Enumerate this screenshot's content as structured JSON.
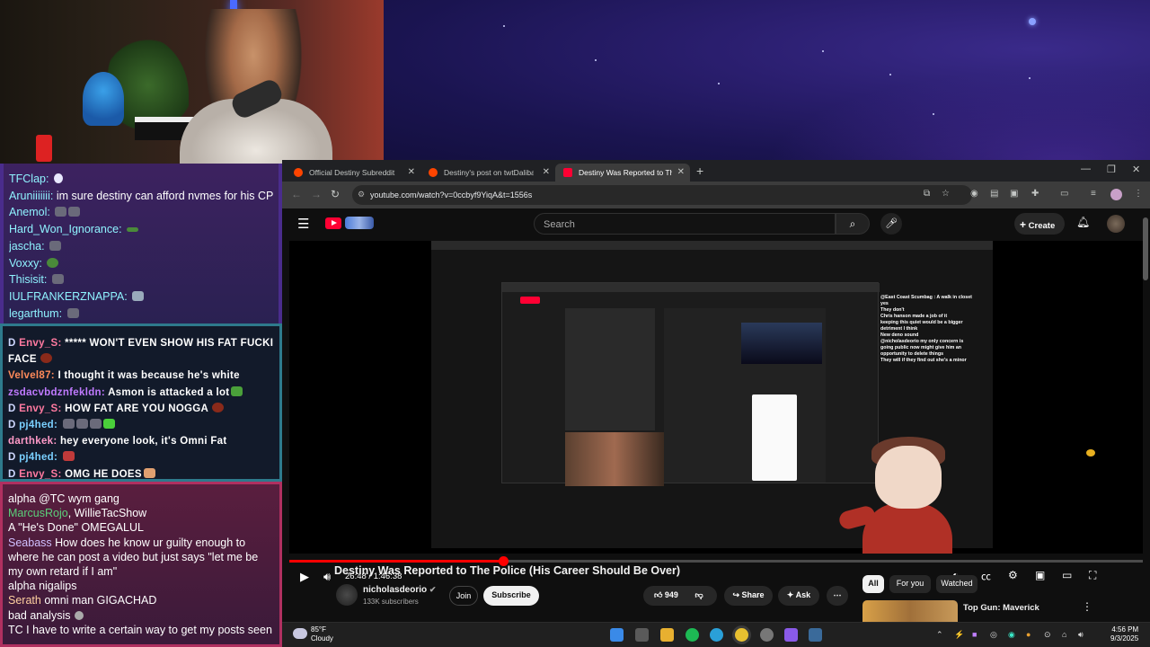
{
  "chat1": {
    "lines": [
      {
        "user": "TFClap:",
        "text": ""
      },
      {
        "user": "Aruniiiiiii:",
        "text": "im sure destiny can afford nvmes for his CP"
      },
      {
        "user": "Anemol:",
        "text": ""
      },
      {
        "user": "Hard_Won_Ignorance:",
        "text": ""
      },
      {
        "user": "jascha:",
        "text": ""
      },
      {
        "user": "Voxxy:",
        "text": ""
      },
      {
        "user": "Thisisit:",
        "text": ""
      },
      {
        "user": "IULFRANKERZNAPPA:",
        "text": ""
      },
      {
        "user": "legarthum:",
        "text": ""
      }
    ]
  },
  "chat2": {
    "lines": [
      {
        "pre": "D",
        "user": "Envy_S:",
        "text": "***** WON'T EVEN SHOW HIS FAT FUCKING",
        "ucolor": "#ff7aa0"
      },
      {
        "pre": "",
        "user": "",
        "text": "FACE",
        "ucolor": "#ffffff"
      },
      {
        "pre": "",
        "user": "Velvel87:",
        "text": "I thought it was because he's white",
        "ucolor": "#ff8a5a"
      },
      {
        "pre": "",
        "user": "zsdacvbdznfekldn:",
        "text": "Asmon is attacked a lot",
        "ucolor": "#c07aff"
      },
      {
        "pre": "D",
        "user": "Envy_S:",
        "text": "HOW FAT ARE YOU NOGGA",
        "ucolor": "#ff7aa0"
      },
      {
        "pre": "D",
        "user": "pj4hed:",
        "text": "",
        "ucolor": "#7ad0ff"
      },
      {
        "pre": "",
        "user": "darthkek:",
        "text": "hey everyone look, it's Omni Fat",
        "ucolor": "#ff9ac8"
      },
      {
        "pre": "D",
        "user": "pj4hed:",
        "text": "",
        "ucolor": "#7ad0ff"
      },
      {
        "pre": "D",
        "user": "Envy_S:",
        "text": "OMG HE DOES",
        "ucolor": "#ff7aa0"
      }
    ]
  },
  "chat3": {
    "lines": [
      {
        "user": "alpha",
        "text": "@TC wym gang",
        "ucolor": "#ffffff"
      },
      {
        "user": "MarcusRojo",
        "text": ", WillieTacShow",
        "ucolor": "#5ad07a"
      },
      {
        "user": "A",
        "text": "\"He's Done\" OMEGALUL",
        "ucolor": "#ffffff"
      },
      {
        "user": "Seabass",
        "text": "How does he know ur guilty enough to where he can post a video but just says \"let me be my own retard if I am\"",
        "ucolor": "#d0c0ff"
      },
      {
        "user": "alpha",
        "text": "nigalips",
        "ucolor": "#ffffff"
      },
      {
        "user": "Serath",
        "text": "omni man GIGACHAD",
        "ucolor": "#ffd0a0"
      },
      {
        "user": "bad analysis",
        "text": "",
        "ucolor": "#ffffff"
      },
      {
        "user": "TC",
        "text": "I have to write a certain way to get my posts seen",
        "ucolor": "#ffffff"
      }
    ]
  },
  "browser": {
    "tabs": [
      {
        "label": "Official Destiny Subreddit",
        "color": "#ff4500"
      },
      {
        "label": "Destiny's post on twtDaliban c...",
        "color": "#ff4500"
      },
      {
        "label": "Destiny Was Reported to The P...",
        "color": "#ff0033"
      }
    ],
    "url": "youtube.com/watch?v=0ccbyf9YiqA&t=1556s"
  },
  "youtube": {
    "search_placeholder": "Search",
    "create_label": "Create",
    "time": "26:48 / 1:46:38",
    "progress_fraction": 0.251,
    "video_title": "Destiny Was Reported to The Police (His Career Should Be Over)",
    "channel": "nicholasdeorio",
    "subs": "133K subscribers",
    "join": "Join",
    "subscribe": "Subscribe",
    "likes": "949",
    "share": "Share",
    "ask": "Ask",
    "chips": [
      "All",
      "For you",
      "Watched"
    ],
    "rec_title": "Top Gun: Maverick",
    "inner_chat": [
      "@East Coast Scumbag : A walk in closet",
      "yes",
      "They don't",
      "Chris hanson made a job of it",
      "keeping this quiet would be a bigger",
      "detriment I think",
      "New deno sound",
      "@nicholasdeorio my only concern is",
      "going public now might give him an",
      "opportunity to delete things",
      "They will if they find out she's a minor"
    ]
  },
  "taskbar": {
    "temp": "85°F",
    "weather": "Cloudy",
    "time": "4:56 PM",
    "date": "9/3/2025"
  }
}
